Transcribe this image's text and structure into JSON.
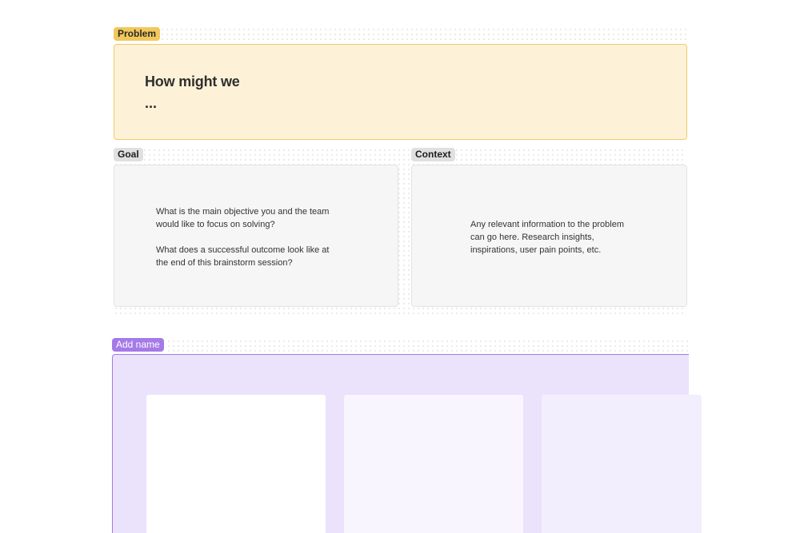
{
  "problem": {
    "tag": "Problem",
    "title": "How might we",
    "ellipsis": "..."
  },
  "goal": {
    "tag": "Goal",
    "paragraphs": [
      "What is the main objective you and the team would like to focus on solving?",
      "What does a successful outcome look like at the end of this brainstorm session?"
    ]
  },
  "context": {
    "tag": "Context",
    "paragraphs": [
      "Any relevant information to the problem can go here. Research insights, inspirations, user pain points, etc."
    ]
  },
  "brainstorm": {
    "tag": "Add name"
  },
  "colors": {
    "problem_accent": "#f2c85b",
    "problem_fill": "#fdf2d8",
    "frame_accent": "#a47ae8",
    "frame_fill": "#ebe2fb",
    "neutral_card": "#f6f6f6"
  }
}
